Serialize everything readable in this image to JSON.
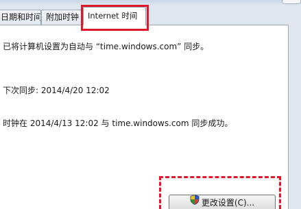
{
  "tabs": {
    "date_time": "日期和时间",
    "additional_clocks": "附加时钟",
    "internet_time": "Internet 时间"
  },
  "content": {
    "sync_info": "已将计算机设置为自动与 “time.windows.com” 同步。",
    "next_sync": "下次同步: 2014/4/20 12:02",
    "last_sync": "时钟在 2014/4/13 12:02 与 time.windows.com 同步成功。"
  },
  "buttons": {
    "change_settings": "更改设置(C)..."
  },
  "colors": {
    "highlight": "#e3172b",
    "panel": "#ffffff",
    "background": "#dfe6ef"
  },
  "icons": {
    "change_settings": "uac-shield-icon"
  }
}
